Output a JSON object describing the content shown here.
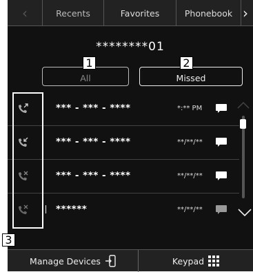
{
  "tabs": {
    "prev_glyph": "‹",
    "recents": "Recents",
    "favorites": "Favorites",
    "phonebook": "Phonebook",
    "next_glyph": "›"
  },
  "dialed_number": "********01",
  "filters": {
    "all": "All",
    "missed": "Missed"
  },
  "callouts": [
    "1",
    "2",
    "3"
  ],
  "calls": [
    {
      "type": "outgoing",
      "number": "*** - *** - ****",
      "time": "*:** PM",
      "icon": "outgoing-call-icon"
    },
    {
      "type": "incoming",
      "number": "*** - *** - ****",
      "time": "**/**/**",
      "icon": "incoming-call-icon"
    },
    {
      "type": "missed",
      "number": "*** - *** - ****",
      "time": "**/**/**",
      "icon": "missed-call-icon"
    },
    {
      "type": "missed",
      "number": "******",
      "time": "**/**/**",
      "icon": "missed-call-icon"
    }
  ],
  "bottom": {
    "manage_devices": "Manage Devices",
    "keypad": "Keypad"
  },
  "colors": {
    "background": "#111111",
    "bar": "#222222",
    "text": "#ffffff",
    "divider": "#444444"
  }
}
